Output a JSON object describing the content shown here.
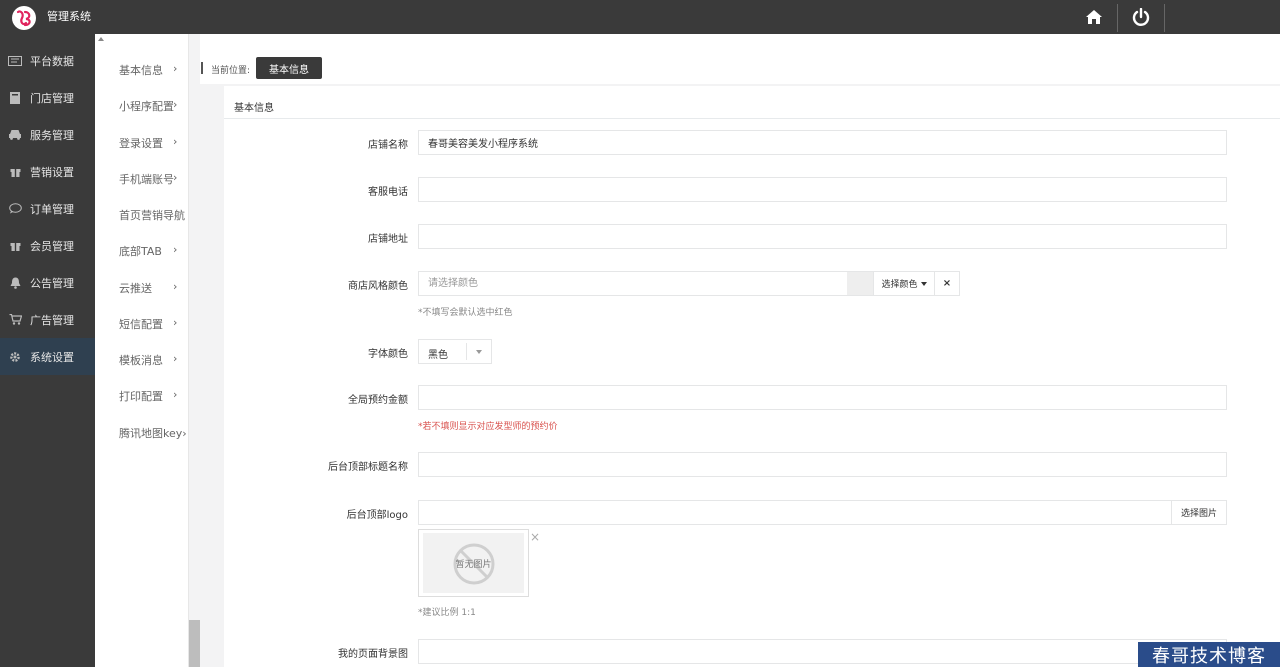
{
  "app": {
    "title": "管理系统"
  },
  "sidebar": {
    "items": [
      {
        "label": "平台数据",
        "icon": "dashboard-icon"
      },
      {
        "label": "门店管理",
        "icon": "store-icon"
      },
      {
        "label": "服务管理",
        "icon": "car-icon"
      },
      {
        "label": "营销设置",
        "icon": "gift-icon"
      },
      {
        "label": "订单管理",
        "icon": "chat-icon"
      },
      {
        "label": "会员管理",
        "icon": "gift-icon"
      },
      {
        "label": "公告管理",
        "icon": "bell-icon"
      },
      {
        "label": "广告管理",
        "icon": "cart-icon"
      },
      {
        "label": "系统设置",
        "icon": "gear-icon",
        "active": true
      }
    ]
  },
  "subnav": {
    "items": [
      {
        "label": "基本信息",
        "arrow": "›"
      },
      {
        "label": "小程序配置",
        "arrow": "›"
      },
      {
        "label": "登录设置",
        "arrow": "›"
      },
      {
        "label": "手机端账号",
        "arrow": "›"
      },
      {
        "label": "首页营销导航",
        "arrow": ""
      },
      {
        "label": "底部TAB",
        "arrow": "›"
      },
      {
        "label": "云推送",
        "arrow": "›"
      },
      {
        "label": "短信配置",
        "arrow": "›"
      },
      {
        "label": "模板消息",
        "arrow": "›"
      },
      {
        "label": "打印配置",
        "arrow": "›"
      },
      {
        "label": "腾讯地图key›",
        "arrow": ""
      }
    ]
  },
  "breadcrumb": {
    "label": "当前位置:",
    "current": "基本信息"
  },
  "panel": {
    "title": "基本信息"
  },
  "form": {
    "shop_name": {
      "label": "店铺名称",
      "value": "春哥美容美发小程序系统"
    },
    "service_phone": {
      "label": "客服电话",
      "value": ""
    },
    "shop_address": {
      "label": "店铺地址",
      "value": ""
    },
    "style_color": {
      "label": "商店风格颜色",
      "placeholder": "请选择颜色",
      "button": "选择颜色",
      "clear": "×",
      "hint": "*不填写会默认选中红色"
    },
    "font_color": {
      "label": "字体颜色",
      "value": "黑色"
    },
    "deposit": {
      "label": "全局预约金额",
      "value": "",
      "hint": "*若不填则显示对应发型师的预约价"
    },
    "admin_title": {
      "label": "后台顶部标题名称",
      "value": ""
    },
    "admin_logo": {
      "label": "后台顶部logo",
      "value": "",
      "button": "选择图片",
      "no_image": "暂无图片",
      "delete": "×",
      "hint": "*建议比例 1:1"
    },
    "my_bg": {
      "label": "我的页面背景图",
      "value": ""
    }
  },
  "watermark": "春哥技术博客",
  "colors": {
    "topbar": "#3a3a3a",
    "sidebar": "#3a3a3a",
    "active": "#2f4050",
    "hint_red": "#d9534f",
    "watermark": "#2a4c8a"
  }
}
